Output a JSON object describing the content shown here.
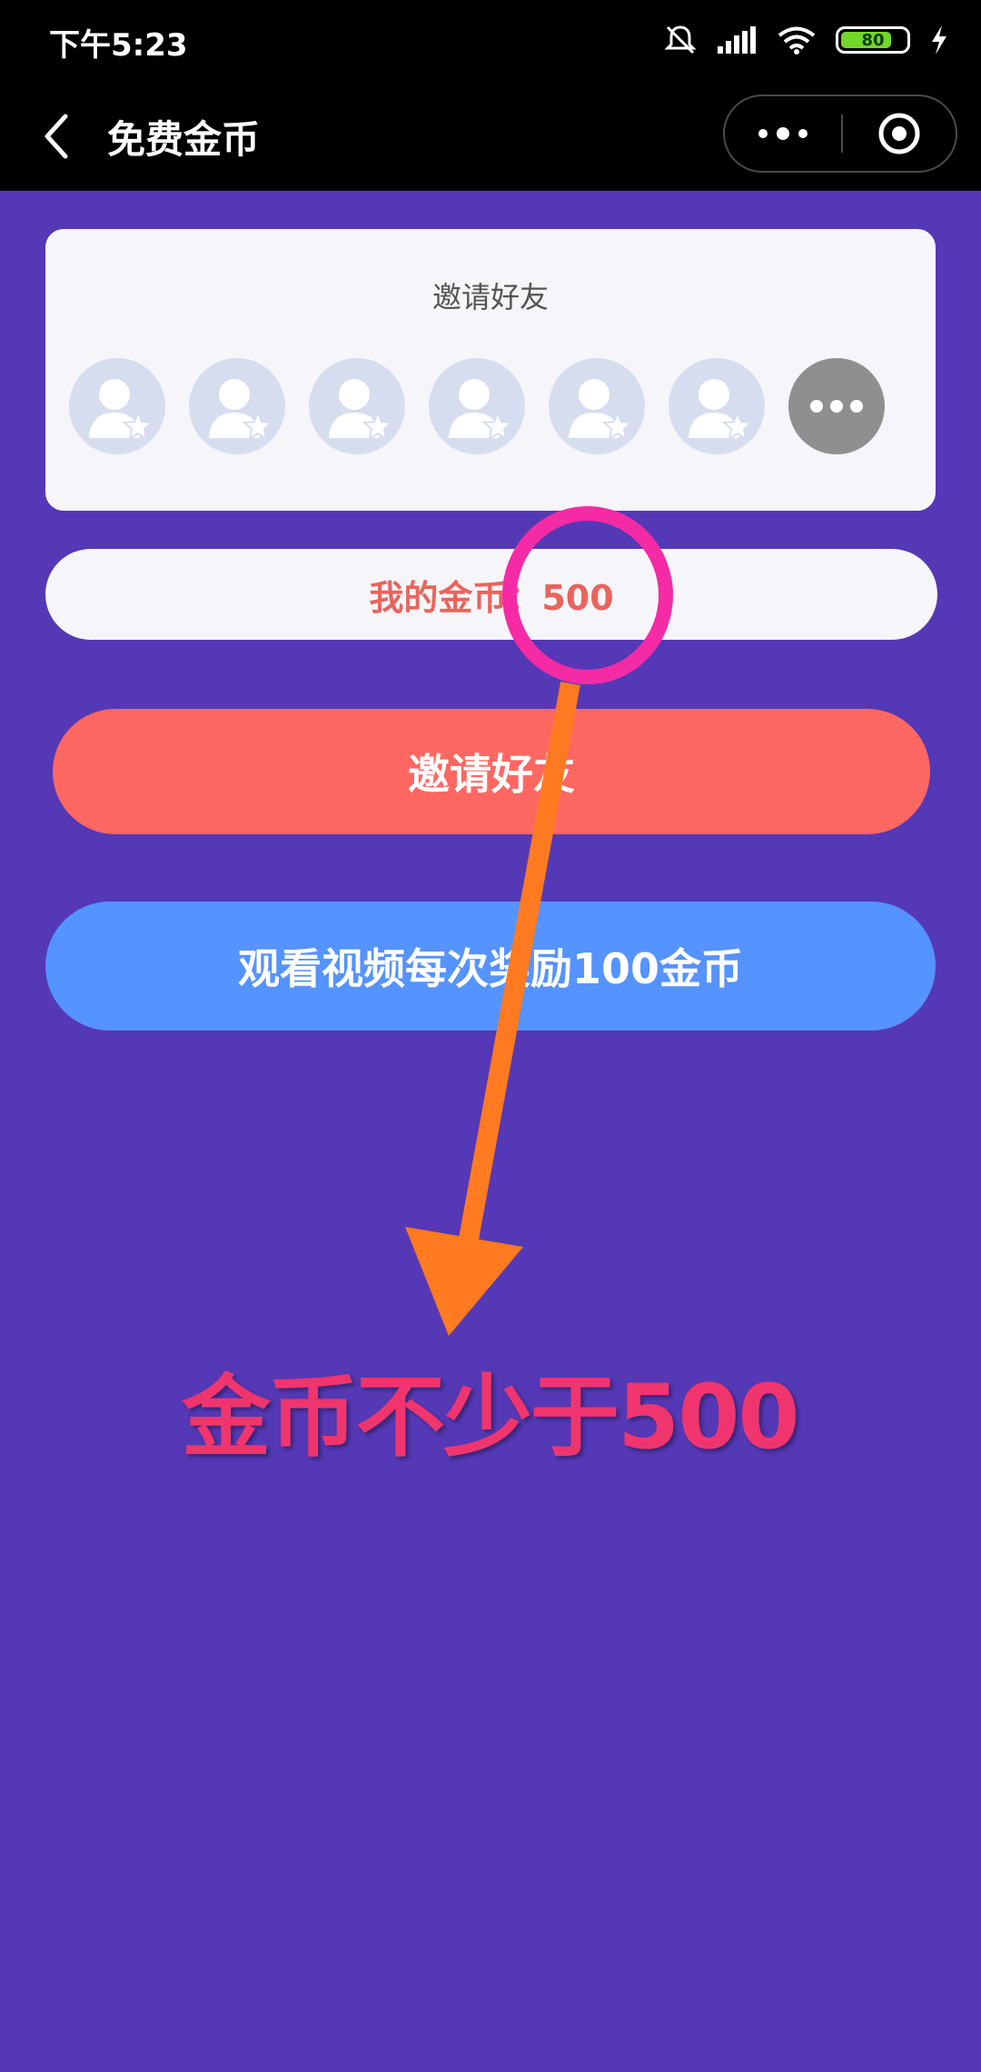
{
  "status_bar": {
    "time": "下午5:23",
    "battery": "80",
    "battery_level_percent": 80,
    "icons": [
      "mute-icon",
      "signal-icon",
      "wifi-icon",
      "battery-icon",
      "charging-icon"
    ]
  },
  "nav": {
    "title": "免费金币",
    "back_icon": "back-chevron-icon",
    "more_icon": "more-dots-icon",
    "close_icon": "target-close-icon"
  },
  "invite_card": {
    "title": "邀请好友",
    "avatar_slots": 6,
    "more_icon": "more-dots-icon"
  },
  "coins": {
    "label": "我的金币：500"
  },
  "buttons": {
    "invite": "邀请好友",
    "watch_video": "观看视频每次奖励100金币"
  },
  "annotation": {
    "text": "金币不少于500"
  },
  "colors": {
    "background": "#5538b5",
    "invite_button": "#ff6762",
    "video_button": "#5593ff",
    "coins_text": "#e9645d",
    "annotation_circle": "#f42ba5",
    "annotation_arrow": "#ff7a20",
    "annotation_text": "#f0356e"
  }
}
